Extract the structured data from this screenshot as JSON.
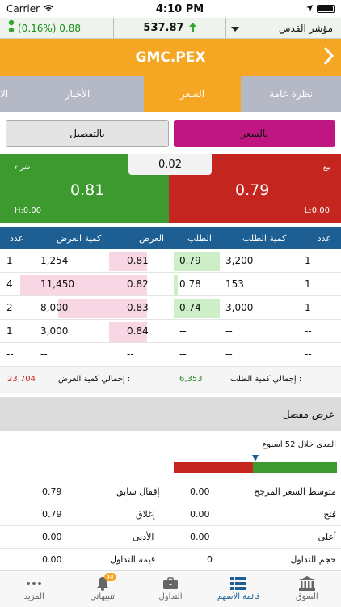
{
  "status_bar": {
    "carrier": "Carrier",
    "time": "4:10 PM"
  },
  "ticker": {
    "change": "(0.16%) 0.88",
    "value": "537.87",
    "index_name": "مؤشر القدس"
  },
  "header": {
    "title": "GMC.PEX"
  },
  "tabs": [
    {
      "label": "الا",
      "active": false
    },
    {
      "label": "الأخبار",
      "active": false
    },
    {
      "label": "السعر",
      "active": true
    },
    {
      "label": "نظرة عامة",
      "active": false
    }
  ],
  "toggle": {
    "detail_label": "بالتفصيل",
    "price_label": "بالسعر"
  },
  "quote": {
    "buy_label": "شراء",
    "buy_price": "0.81",
    "high": "H:0.00",
    "sell_label": "بيع",
    "sell_price": "0.79",
    "low": "L:0.00",
    "spread": "0.02"
  },
  "order_book": {
    "headers": [
      "عدد",
      "كمية العرض",
      "العرض",
      "الطلب",
      "كمية الطلب",
      "عدد"
    ],
    "rows": [
      {
        "ask_count": "1",
        "ask_qty": "1,254",
        "ask": "0.81",
        "bid": "0.79",
        "bid_qty": "3,200",
        "bid_count": "1",
        "ask_depth": 0.3,
        "bid_depth": 0.6
      },
      {
        "ask_count": "4",
        "ask_qty": "11,450",
        "ask": "0.82",
        "bid": "0.78",
        "bid_qty": "153",
        "bid_count": "1",
        "ask_depth": 1.0,
        "bid_depth": 0.05
      },
      {
        "ask_count": "2",
        "ask_qty": "8,000",
        "ask": "0.83",
        "bid": "0.74",
        "bid_qty": "3,000",
        "bid_count": "1",
        "ask_depth": 0.7,
        "bid_depth": 0.6
      },
      {
        "ask_count": "1",
        "ask_qty": "3,000",
        "ask": "0.84",
        "bid": "--",
        "bid_qty": "--",
        "bid_count": "--",
        "ask_depth": 0.3,
        "bid_depth": 0
      },
      {
        "ask_count": "--",
        "ask_qty": "--",
        "ask": "--",
        "bid": "--",
        "bid_qty": "--",
        "bid_count": "--",
        "ask_depth": 0,
        "bid_depth": 0
      }
    ],
    "total_ask_value": "23,704",
    "total_ask_label": "إجمالي كمية العرض :",
    "total_bid_value": "6,353",
    "total_bid_label": "إجمالي كمية الطلب :"
  },
  "detail": {
    "section_title": "عرض مفصل",
    "range_title": "المدى خلال 52 اسبوع",
    "stats": [
      {
        "l_value": "0.79",
        "l_label": "إقفال سابق",
        "r_value": "0.00",
        "r_label": "متوسط السعر المرجح"
      },
      {
        "l_value": "0.79",
        "l_label": "إغلاق",
        "r_value": "0.00",
        "r_label": "فتح"
      },
      {
        "l_value": "0.00",
        "l_label": "الأدنى",
        "r_value": "0.00",
        "r_label": "أعلى"
      },
      {
        "l_value": "0.00",
        "l_label": "قيمة التداول",
        "r_value": "0",
        "r_label": "حجم التداول"
      }
    ]
  },
  "bottom_nav": [
    {
      "label": "المزيد",
      "icon": "more-icon",
      "active": false
    },
    {
      "label": "تنبيهاتي",
      "icon": "bell-icon",
      "active": false,
      "badge": "40"
    },
    {
      "label": "التداول",
      "icon": "briefcase-icon",
      "active": false
    },
    {
      "label": "قائمة الأسهم",
      "icon": "list-icon",
      "active": true
    },
    {
      "label": "السوق",
      "icon": "bank-icon",
      "active": false
    }
  ],
  "colors": {
    "accent": "#f5a623",
    "buy": "#3c9a2f",
    "sell": "#c4251f",
    "header_blue": "#1e5f93",
    "ask_bar": "#f9d6e4",
    "bid_bar": "#cdeec7"
  }
}
